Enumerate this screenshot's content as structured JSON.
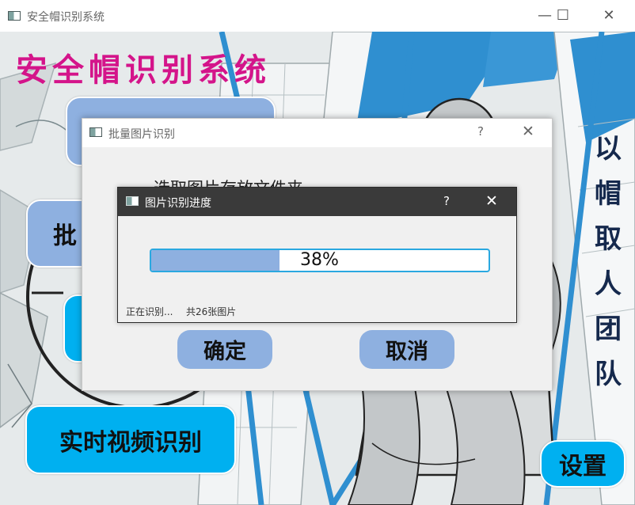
{
  "window": {
    "title": "安全帽识别系统",
    "controls": {
      "minimize": "—",
      "maximize": "☐",
      "close": "✕"
    }
  },
  "main": {
    "heading": "安全帽识别系统",
    "slogan": [
      "以",
      "帽",
      "取",
      "人",
      "团",
      "队"
    ],
    "buttons": {
      "batch_partial": "批",
      "realtime_video": "实时视频识别",
      "settings": "设置"
    }
  },
  "batch_dialog": {
    "title": "批量图片识别",
    "help": "?",
    "close": "✕",
    "prompt": "选取图片存放文件夹",
    "confirm": "确定",
    "cancel": "取消"
  },
  "progress_dialog": {
    "title": "图片识别进度",
    "help": "?",
    "close": "✕",
    "progress": 0.38,
    "progress_label": "38%",
    "status": "正在识别...",
    "total": "共26张图片"
  },
  "colors": {
    "heading": "#d4148a",
    "button_blue": "#00b0f0",
    "dialog_button": "#8eb0e0",
    "progress_border": "#2aa8e0",
    "slogan": "#15294d"
  },
  "icons": {
    "app": "app-window-icon"
  }
}
